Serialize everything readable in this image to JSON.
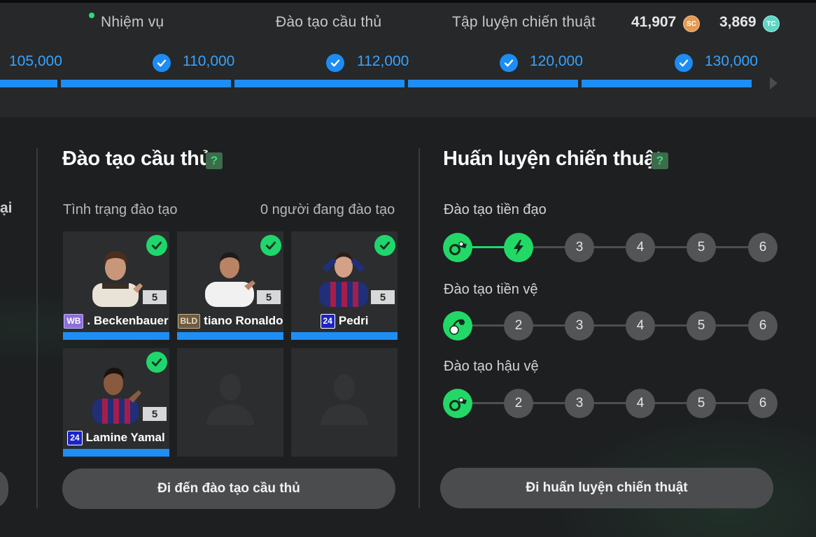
{
  "header": {
    "tabs": [
      {
        "label": "Nhiệm vụ",
        "has_notification": true
      },
      {
        "label": "Đào tạo cầu thủ"
      },
      {
        "label": "Tập luyện chiến thuật"
      }
    ],
    "currencies": [
      {
        "value": "41,907",
        "icon": "sc-coin-icon",
        "icon_text": "SC",
        "color": "#e39a54"
      },
      {
        "value": "3,869",
        "icon": "tc-coin-icon",
        "icon_text": "TC",
        "color": "#5fd5c3"
      }
    ]
  },
  "milestones": [
    {
      "value": "105,000",
      "completed": true
    },
    {
      "value": "110,000",
      "completed": true
    },
    {
      "value": "112,000",
      "completed": true
    },
    {
      "value": "120,000",
      "completed": true
    },
    {
      "value": "130,000",
      "completed": true
    }
  ],
  "left_panel": {
    "partial_text": "ại"
  },
  "player_training": {
    "title": "Đào tạo cầu thủ",
    "help": "?",
    "status_label": "Tình trạng đào tạo",
    "count_label": "0 người đang đào tạo",
    "cards": [
      {
        "name": ". Beckenbauer",
        "season": "WB",
        "level": "5",
        "completed": true
      },
      {
        "name": "tiano Ronaldo",
        "season": "BLD",
        "level": "5",
        "completed": true
      },
      {
        "name": "Pedri",
        "season": "24",
        "level": "5",
        "completed": true
      },
      {
        "name": "Lamine Yamal",
        "season": "24",
        "level": "5",
        "completed": true
      },
      {
        "name": "",
        "empty": true
      },
      {
        "name": "",
        "empty": true
      }
    ],
    "button_label": "Đi đến đào tạo cầu thủ"
  },
  "tactical_training": {
    "title": "Huấn luyện chiến thuật",
    "help": "?",
    "tracks": [
      {
        "label": "Đào tạo tiền đạo",
        "nodes": [
          "striker-icon",
          "lightning-icon",
          "3",
          "4",
          "5",
          "6"
        ],
        "active_count": 2
      },
      {
        "label": "Đào tạo tiền vệ",
        "nodes": [
          "midfielder-icon",
          "2",
          "3",
          "4",
          "5",
          "6"
        ],
        "active_count": 1
      },
      {
        "label": "Đào tạo hậu vệ",
        "nodes": [
          "defender-icon",
          "2",
          "3",
          "4",
          "5",
          "6"
        ],
        "active_count": 1
      }
    ],
    "button_label": "Đi huấn luyện chiến thuật"
  },
  "colors": {
    "accent_blue": "#1e8ef5",
    "accent_green": "#22d866",
    "background": "#1e2022"
  }
}
